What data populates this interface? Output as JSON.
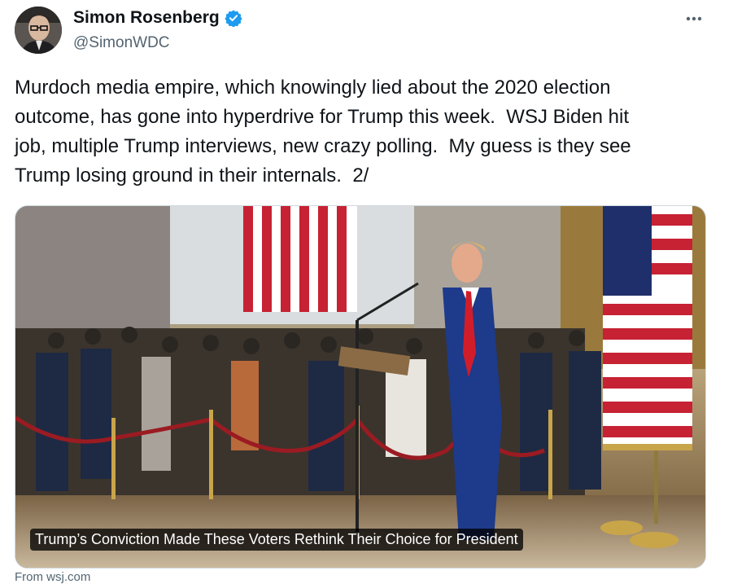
{
  "author": {
    "display_name": "Simon Rosenberg",
    "handle": "@SimonWDC",
    "verified_color": "#1d9bf0",
    "icons": {
      "verified": "verified-badge-icon",
      "more": "more-horizontal-icon"
    }
  },
  "tweet": {
    "text": "Murdoch media empire, which knowingly lied about the 2020 election\noutcome, has gone into hyperdrive for Trump this week.  WSJ Biden hit\njob, multiple Trump interviews, new crazy polling.  My guess is they see\nTrump losing ground in their internals.  2/"
  },
  "card": {
    "caption": "Trump’s Conviction Made These Voters Rethink Their Choice for President",
    "source": "From wsj.com"
  }
}
